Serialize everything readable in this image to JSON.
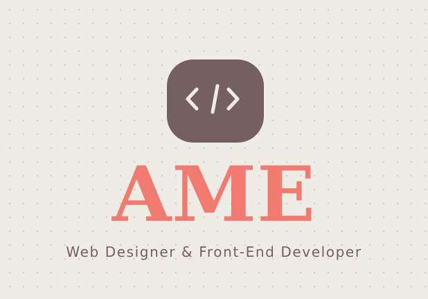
{
  "logo": {
    "icon": "code-brackets-icon",
    "brand_name": "AME",
    "tagline": "Web Designer & Front-End Developer"
  },
  "colors": {
    "background": "#efebe5",
    "dot_grid": "#9c918b",
    "icon_tile": "#74615f",
    "icon_glyph": "#efebe5",
    "brand_name": "#f27a6e",
    "tagline": "#74615f"
  }
}
